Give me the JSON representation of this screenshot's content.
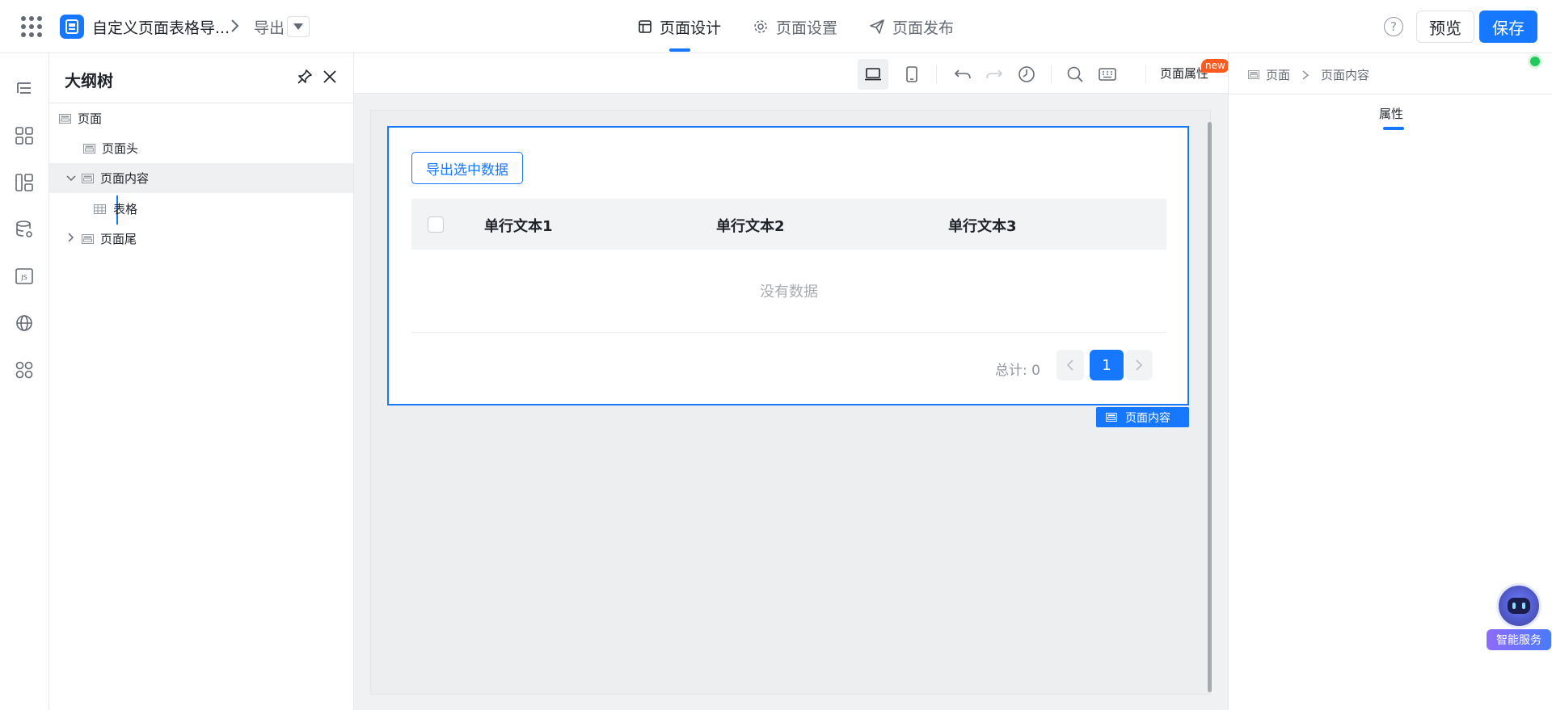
{
  "topbar": {
    "app_title": "自定义页面表格导...",
    "breadcrumb_page": "导出",
    "tabs": [
      {
        "label": "页面设计",
        "icon": "layout-icon",
        "active": true
      },
      {
        "label": "页面设置",
        "icon": "gear-icon",
        "active": false
      },
      {
        "label": "页面发布",
        "icon": "send-icon",
        "active": false
      }
    ],
    "help_label": "?",
    "preview_label": "预览",
    "save_label": "保存",
    "accent": "#1677ff"
  },
  "rail": {
    "items": [
      "outline-icon",
      "components-icon",
      "layout-icon",
      "datasource-icon",
      "js-icon",
      "globe-icon",
      "apps-icon"
    ]
  },
  "outline": {
    "title": "大纲树",
    "nodes": [
      {
        "label": "页面"
      },
      {
        "label": "页面头"
      },
      {
        "label": "页面内容",
        "selected": true,
        "expanded": true
      },
      {
        "label": "表格"
      },
      {
        "label": "页面尾",
        "collapsed": true
      }
    ]
  },
  "canvas": {
    "toolbar": {
      "page_attr_label": "页面属性",
      "new_badge": "new"
    },
    "export_button": "导出选中数据",
    "table": {
      "columns": [
        "单行文本1",
        "单行文本2",
        "单行文本3"
      ],
      "empty_text": "没有数据",
      "total_text": "总计: 0",
      "current_page": "1"
    },
    "content_tag": "页面内容"
  },
  "right_panel": {
    "breadcrumb": [
      "页面",
      "页面内容"
    ],
    "tab_label": "属性",
    "status_color": "#1fc95a"
  },
  "assistant": {
    "label": "智能服务"
  }
}
